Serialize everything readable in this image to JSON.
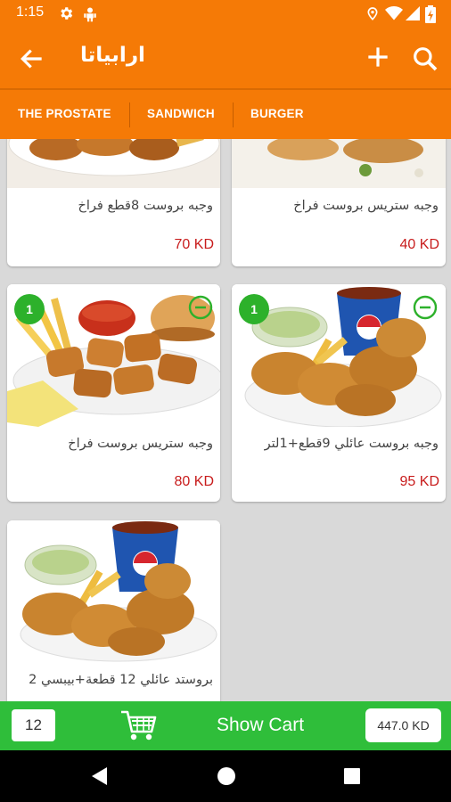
{
  "status": {
    "time": "1:15",
    "icons": [
      "settings-icon",
      "android-debug-icon",
      "location-icon",
      "wifi-icon",
      "signal-icon",
      "battery-icon"
    ]
  },
  "header": {
    "title": "ارابياتا",
    "back_icon": "arrow-left-icon",
    "add_icon": "plus-icon",
    "search_icon": "search-icon"
  },
  "categories": [
    {
      "label": "THE PROSTATE"
    },
    {
      "label": "SANDWICH"
    },
    {
      "label": "BURGER"
    }
  ],
  "products": [
    {
      "name": "وجبه بروست 8قطع فراخ",
      "price": "70 KD"
    },
    {
      "name": "وجبه ستريس بروست فراخ",
      "price": "40 KD"
    },
    {
      "name": "وجبه ستريس بروست فراخ",
      "price": "80 KD",
      "qty": "1"
    },
    {
      "name": "وجبه بروست عائلي 9قطع+1لتر",
      "price": "95 KD",
      "qty": "1"
    },
    {
      "name": "بروستد عائلي 12 قطعة+بيبسي 2"
    }
  ],
  "cart": {
    "count": "12",
    "label": "Show Cart",
    "total": "447.0 KD"
  },
  "colors": {
    "primary": "#f57a06",
    "accent_green": "#2fbe3a",
    "price_red": "#c81c1c"
  }
}
